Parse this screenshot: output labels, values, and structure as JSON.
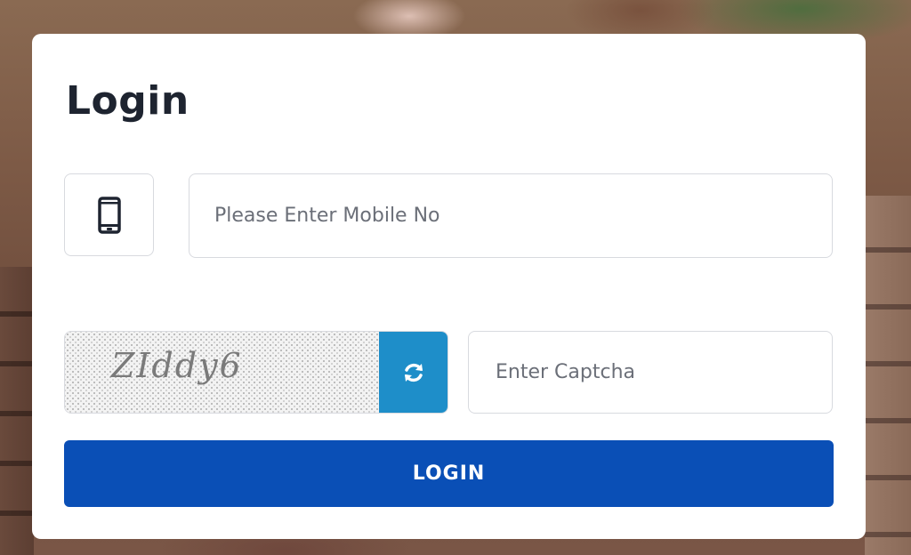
{
  "login_form": {
    "title": "Login",
    "mobile_field": {
      "icon": "mobile-phone-icon",
      "placeholder": "Please Enter Mobile No",
      "value": ""
    },
    "captcha": {
      "text": "ZIddy6",
      "refresh_icon": "refresh-icon",
      "input_placeholder": "Enter Captcha",
      "input_value": ""
    },
    "login_button_label": "LOGIN"
  },
  "colors": {
    "primary_button": "#0a4fb6",
    "refresh_button": "#1e8ec9",
    "title_text": "#1e2430",
    "input_border": "#d8dadf"
  }
}
